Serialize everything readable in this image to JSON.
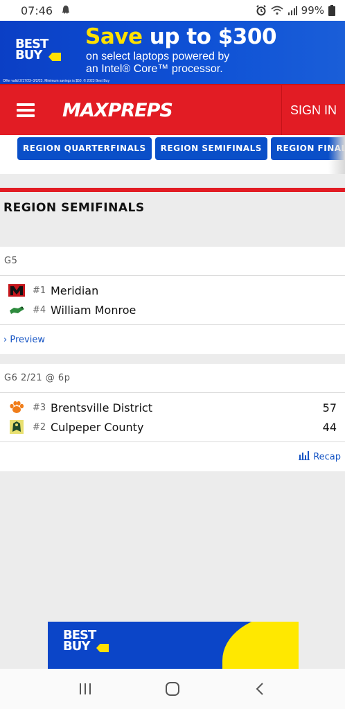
{
  "status_bar": {
    "time": "07:46",
    "battery": "99%"
  },
  "ad_top": {
    "brand": "BEST BUY",
    "headline_highlight": "Save",
    "headline_rest": "up to $300",
    "sub_line1": "on select laptops powered by",
    "sub_line2": "an Intel® Core™ processor.",
    "fine_print": "Offer valid 2/17/23–3/2/23. Minimum savings is $50. © 2023 Best Buy"
  },
  "header": {
    "logo": "MAXPREPS",
    "sign_in": "SIGN IN"
  },
  "round_tabs": [
    "REGION QUARTERFINALS",
    "REGION SEMIFINALS",
    "REGION FINALS"
  ],
  "section": {
    "title": "REGION SEMIFINALS"
  },
  "games": [
    {
      "label": "G5",
      "teams": [
        {
          "seed": "#1",
          "name": "Meridian",
          "score": ""
        },
        {
          "seed": "#4",
          "name": "William Monroe",
          "score": ""
        }
      ],
      "link": "Preview"
    },
    {
      "label": "G6 2/21 @ 6p",
      "teams": [
        {
          "seed": "#3",
          "name": "Brentsville District",
          "score": "57"
        },
        {
          "seed": "#2",
          "name": "Culpeper County",
          "score": "44"
        }
      ],
      "link": "Recap"
    }
  ],
  "ad_bottom": {
    "brand": "BEST BUY"
  },
  "colors": {
    "maxpreps_red": "#e21c24",
    "tab_blue": "#0a4fc8",
    "link_blue": "#1554c4",
    "bestbuy_yellow": "#ffe000"
  },
  "icons": [
    "ghost-notification-icon",
    "alarm-icon",
    "wifi-icon",
    "signal-icon",
    "battery-icon",
    "menu-icon",
    "chevron-right-icon",
    "bar-chart-icon",
    "recents-icon",
    "home-icon",
    "back-icon"
  ]
}
